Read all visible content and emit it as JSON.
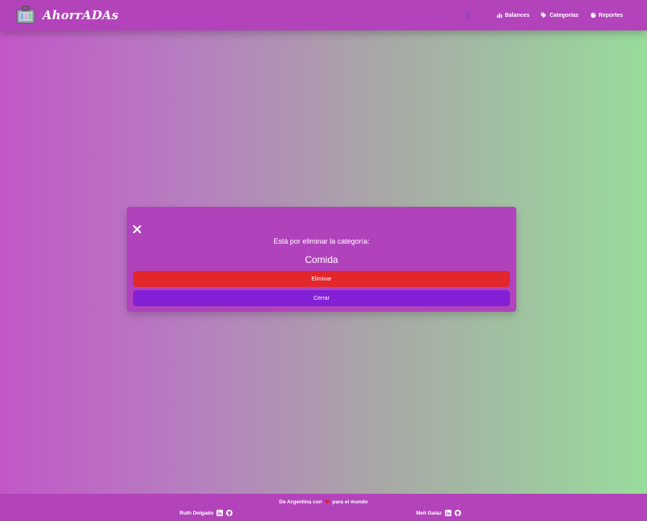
{
  "app": {
    "brand": "AhorrADAs"
  },
  "nav": {
    "items": [
      {
        "label": "Balances",
        "icon": "chart-icon"
      },
      {
        "label": "Categorías",
        "icon": "tag-icon"
      },
      {
        "label": "Reportes",
        "icon": "pie-icon"
      }
    ]
  },
  "modal": {
    "message": "Está por eliminar la categoría:",
    "category": "Comida",
    "delete_label": "Eliminar",
    "close_label": "Cerrar"
  },
  "footer": {
    "line_prefix": "De Argentina con",
    "line_suffix": "para el mundo",
    "authors": [
      "Ruth Delgado",
      "Meli Galaz"
    ]
  },
  "colors": {
    "navbar": "#b343bb",
    "delete": "#e2262b",
    "close": "#8320d6",
    "moon": "#3b54e6"
  }
}
